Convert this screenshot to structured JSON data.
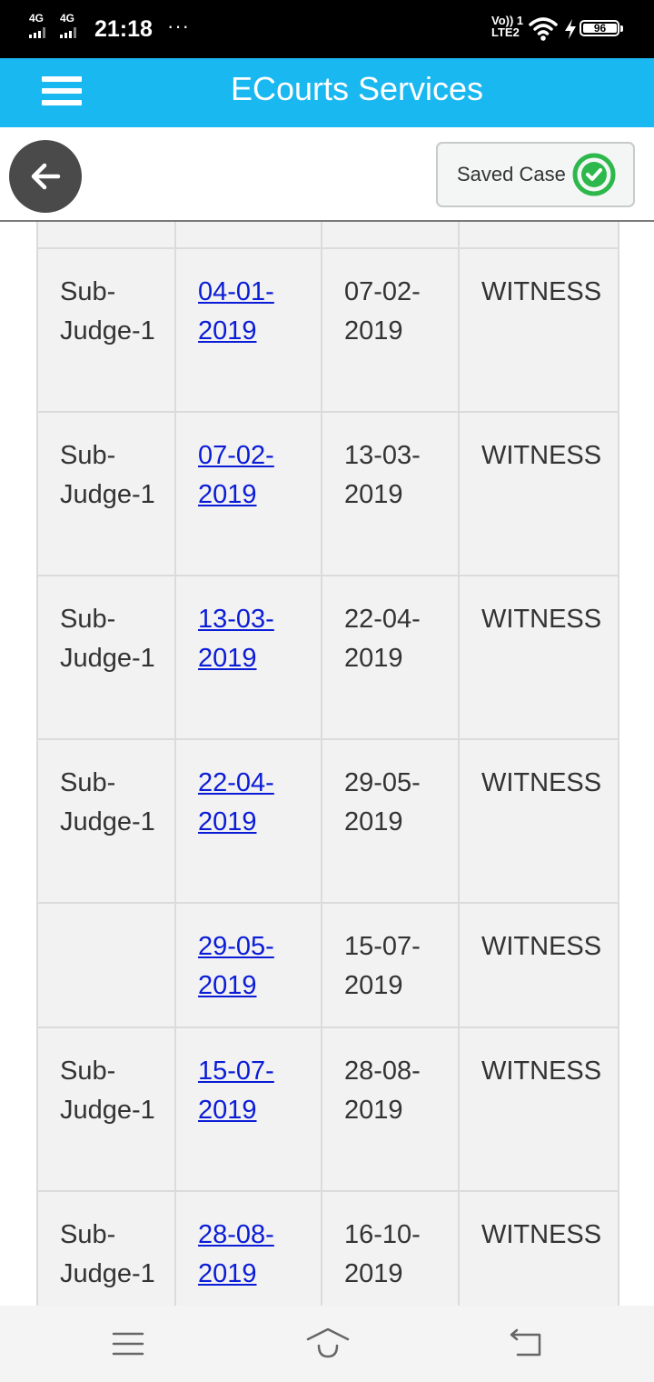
{
  "status_bar": {
    "network1": "4G",
    "network2": "4G",
    "time": "21:18",
    "more": "···",
    "volte_top": "Vo)) 1",
    "volte_bottom": "LTE2",
    "battery": "96"
  },
  "app_bar": {
    "title": "ECourts Services",
    "menu_icon": "hamburger-menu-icon"
  },
  "toolbar": {
    "back_icon": "arrow-left-icon",
    "saved_case_label": "Saved Case",
    "saved_icon": "green-check-circle-icon",
    "accent_color": "#1ab8f0",
    "check_color": "#2db84c"
  },
  "case_history": {
    "rows": [
      {
        "judge": "Sub-Judge-1",
        "business_date": "04-01-2019",
        "hearing_date": "07-02-2019",
        "purpose": "WITNESS"
      },
      {
        "judge": "Sub-Judge-1",
        "business_date": "07-02-2019",
        "hearing_date": "13-03-2019",
        "purpose": "WITNESS"
      },
      {
        "judge": "Sub-Judge-1",
        "business_date": "13-03-2019",
        "hearing_date": "22-04-2019",
        "purpose": "WITNESS"
      },
      {
        "judge": "Sub-Judge-1",
        "business_date": "22-04-2019",
        "hearing_date": "29-05-2019",
        "purpose": "WITNESS"
      },
      {
        "judge": "",
        "business_date": "29-05-2019",
        "hearing_date": "15-07-2019",
        "purpose": "WITNESS"
      },
      {
        "judge": "Sub-Judge-1",
        "business_date": "15-07-2019",
        "hearing_date": "28-08-2019",
        "purpose": "WITNESS"
      },
      {
        "judge": "Sub-Judge-1",
        "business_date": "28-08-2019",
        "hearing_date": "16-10-2019",
        "purpose": "WITNESS"
      }
    ]
  },
  "nav_bar": {
    "recents_icon": "recents-menu-icon",
    "home_icon": "home-icon",
    "back_icon": "back-return-icon"
  }
}
